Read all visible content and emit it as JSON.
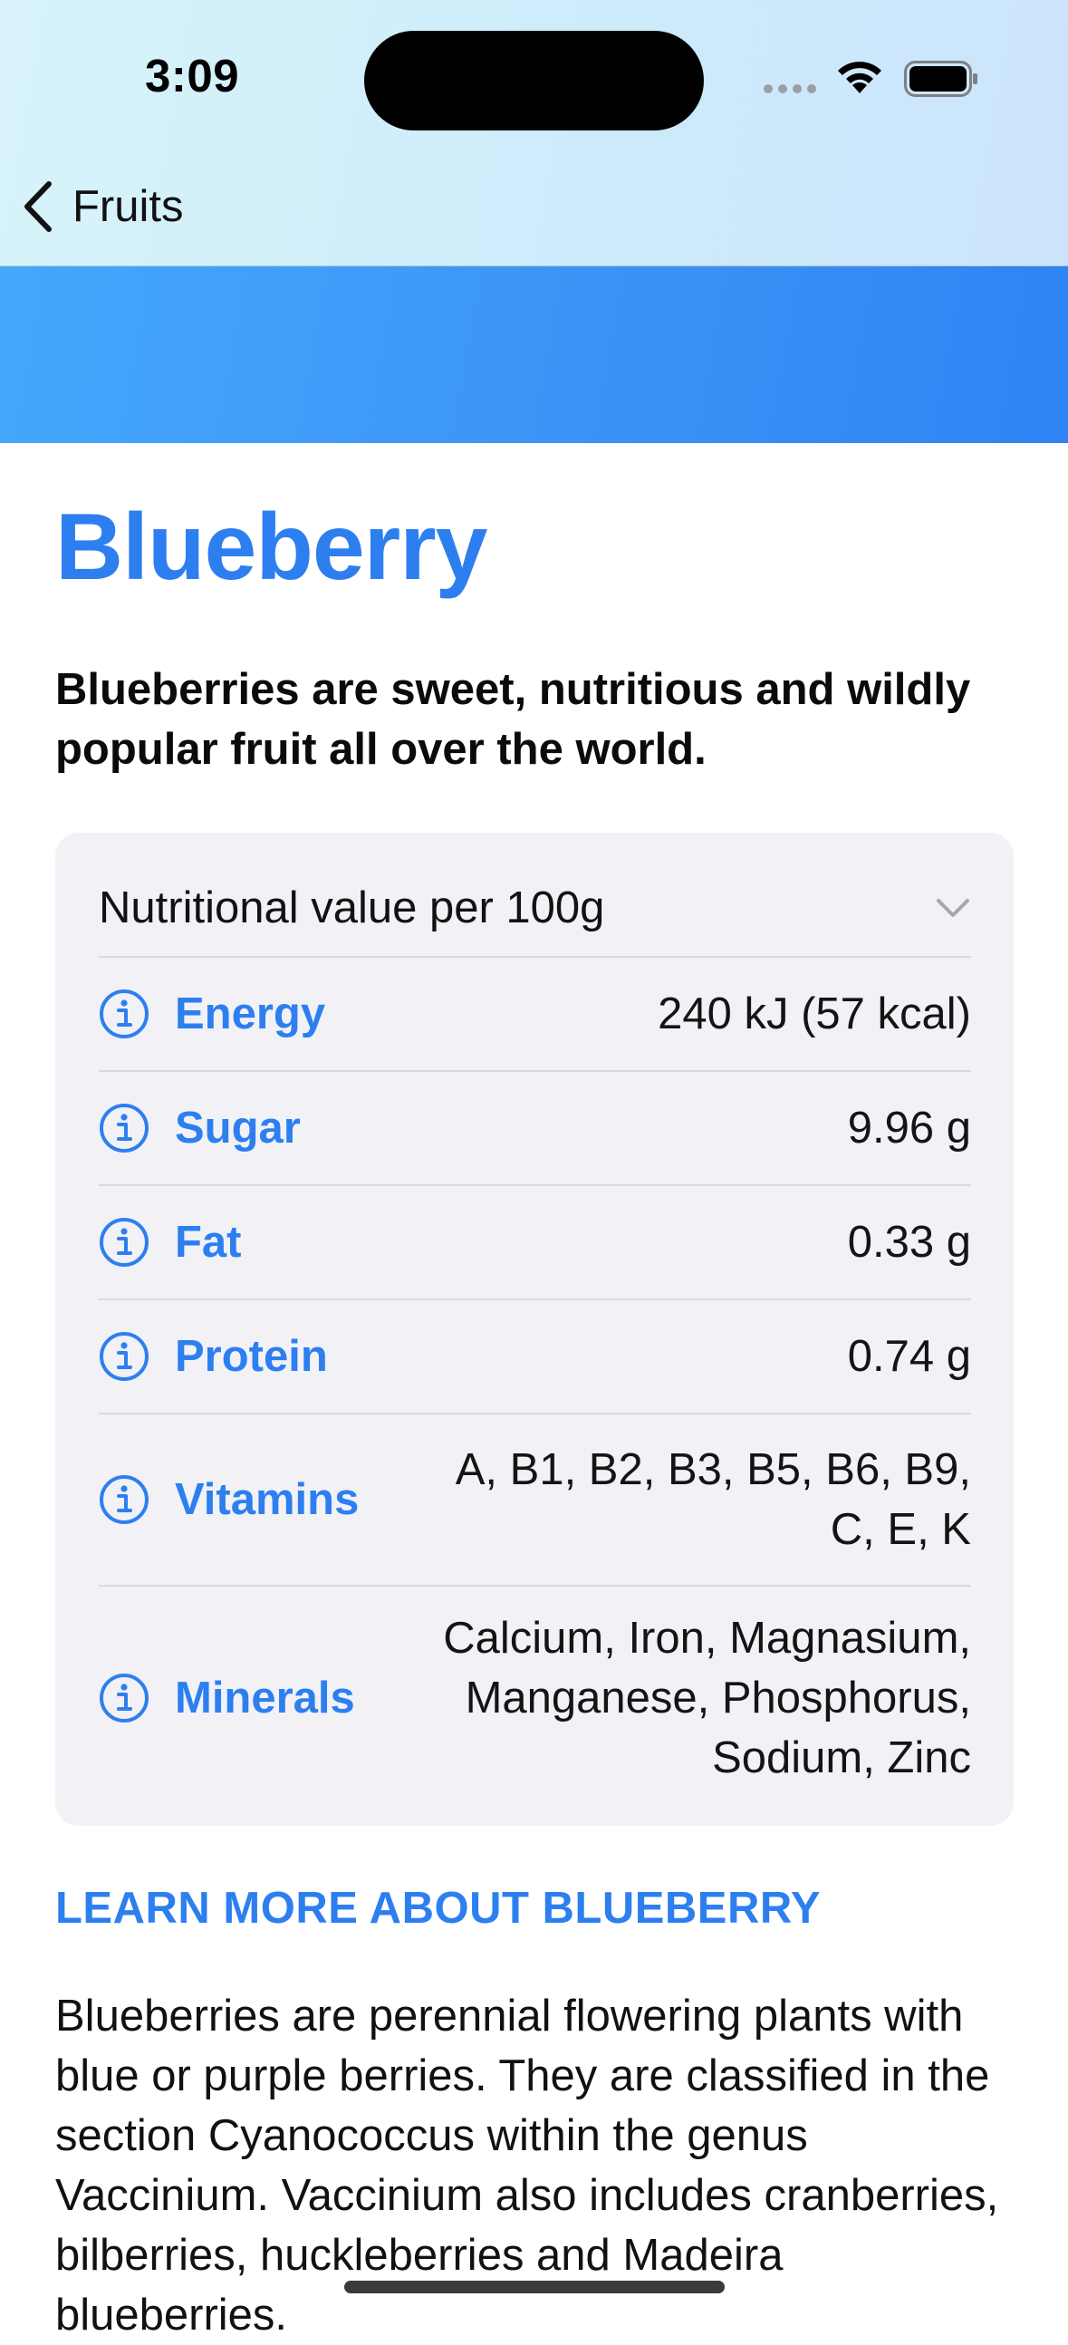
{
  "status_bar": {
    "time": "3:09"
  },
  "nav": {
    "back_label": "Fruits",
    "back_icon": "chevron-left-icon"
  },
  "colors": {
    "accent": "#2d7ff0",
    "hero_gradient_start": "#44a8fb",
    "hero_gradient_end": "#2f83f3",
    "card_background": "#f1f1f6"
  },
  "fruit": {
    "title": "Blueberry",
    "headline": "Blueberries are sweet, nutritious and wildly popular fruit all over the world."
  },
  "nutrition": {
    "header": "Nutritional value per 100g",
    "expand_icon": "chevron-down-icon",
    "rows": [
      {
        "label": "Energy",
        "value": "240 kJ (57 kcal)",
        "icon": "info-icon"
      },
      {
        "label": "Sugar",
        "value": "9.96 g",
        "icon": "info-icon"
      },
      {
        "label": "Fat",
        "value": "0.33 g",
        "icon": "info-icon"
      },
      {
        "label": "Protein",
        "value": "0.74 g",
        "icon": "info-icon"
      },
      {
        "label": "Vitamins",
        "value": "A, B1, B2, B3, B5, B6, B9, C, E, K",
        "icon": "info-icon"
      },
      {
        "label": "Minerals",
        "value": "Calcium, Iron, Magnasium, Manganese, Phosphorus, Sodium, Zinc",
        "icon": "info-icon"
      }
    ]
  },
  "learn_more": {
    "heading": "LEARN MORE ABOUT BLUEBERRY",
    "body": "Blueberries are perennial flowering plants with blue or purple berries. They are classified in the section Cyanococcus within the genus Vaccinium. Vaccinium also includes cranberries, bilberries, huckleberries and Madeira blueberries."
  }
}
